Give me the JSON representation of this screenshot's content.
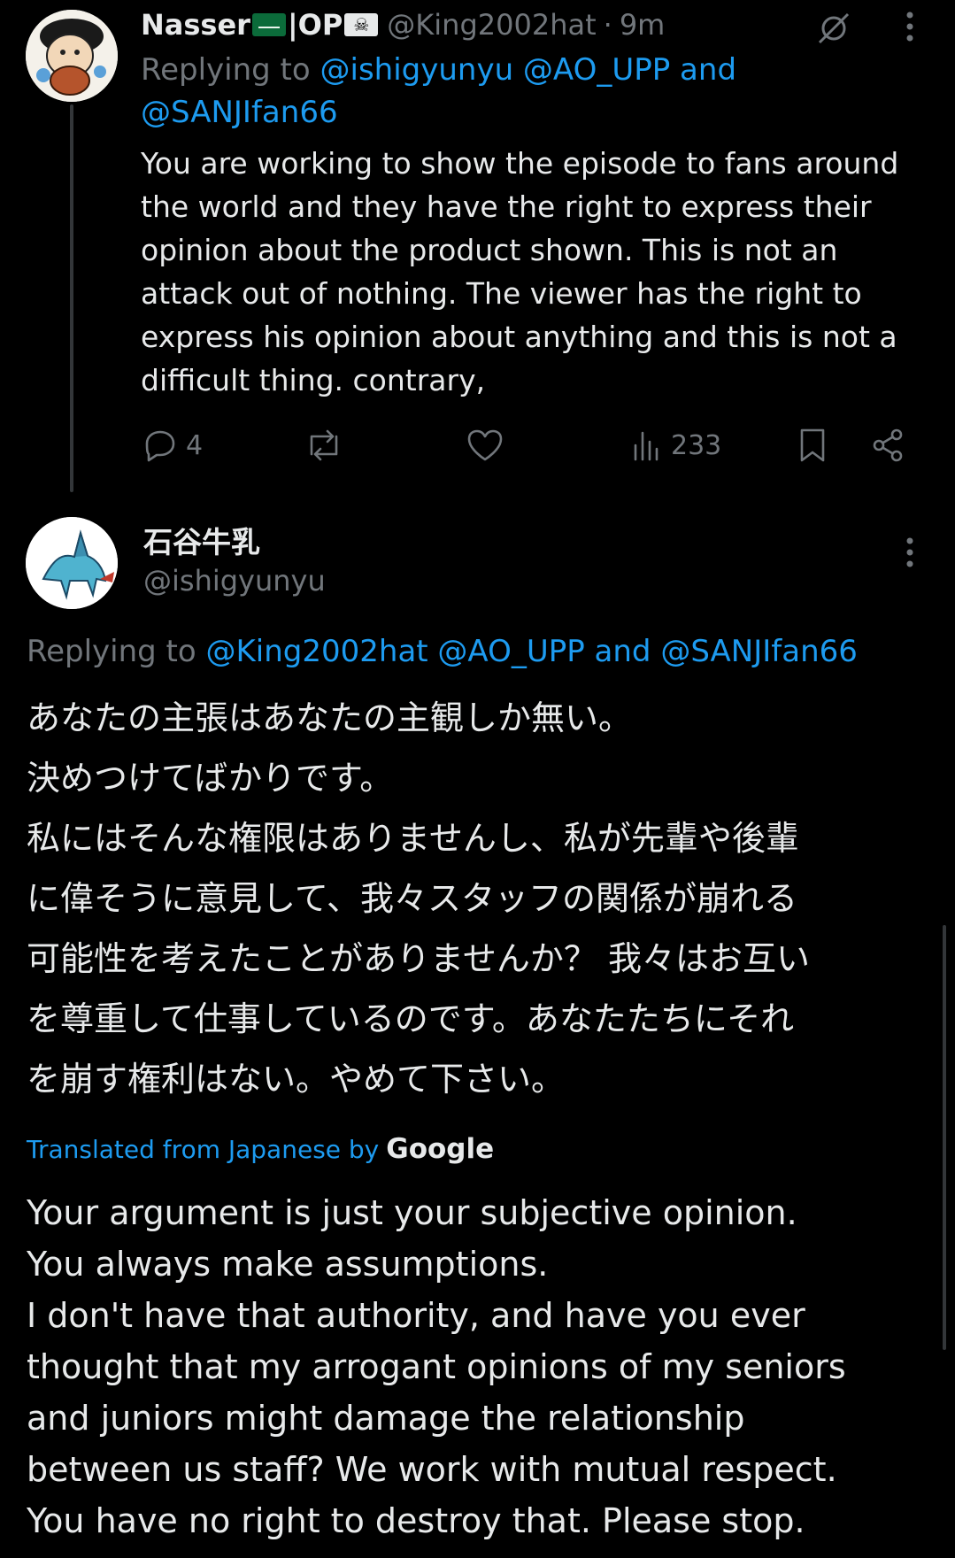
{
  "tweet1": {
    "display_name": "Nasser",
    "name_suffix": "|OP",
    "handle": "@King2002hat",
    "time": "9m",
    "replying_prefix": "Replying to",
    "replying_users": "@ishigyunyu @AO_UPP and",
    "replying_users_line2": "@SANJIfan66",
    "body_lines": [
      "You are working to show the episode to fans around",
      "the world and they have the right to express their",
      "opinion about the product shown. This is not an",
      "attack out of nothing. The viewer has the right to",
      "express his opinion about anything and this is not a",
      "difficult thing. contrary,"
    ],
    "reply_count": "4",
    "views": "233"
  },
  "tweet2": {
    "display_name": "石谷牛乳",
    "handle": "@ishigyunyu",
    "replying_prefix": "Replying to",
    "replying_users": "@King2002hat @AO_UPP and @SANJIfan66",
    "japanese_lines": [
      "あなたの主張はあなたの主観しか無い。",
      "決めつけてばかりです。",
      "私にはそんな権限はありませんし、私が先輩や後輩",
      "に偉そうに意見して、我々スタッフの関係が崩れる",
      "可能性を考えたことがありませんか？ 我々はお互い",
      "を尊重して仕事しているのです。あなたたちにそれ",
      "を崩す権利はない。やめて下さい。"
    ],
    "translated_label": "Translated from Japanese by",
    "translator": "Google",
    "translation_lines": [
      "Your argument is just your subjective opinion.",
      "You always make assumptions.",
      "I don't have that authority, and have you ever",
      "thought that my arrogant opinions of my seniors",
      "and juniors might damage the relationship",
      "between us staff? We work with mutual respect.",
      "You have no right to destroy that. Please stop."
    ]
  },
  "colors": {
    "background": "#000000",
    "text": "#e7e9ea",
    "muted": "#71767b",
    "link": "#1d9bf0"
  }
}
